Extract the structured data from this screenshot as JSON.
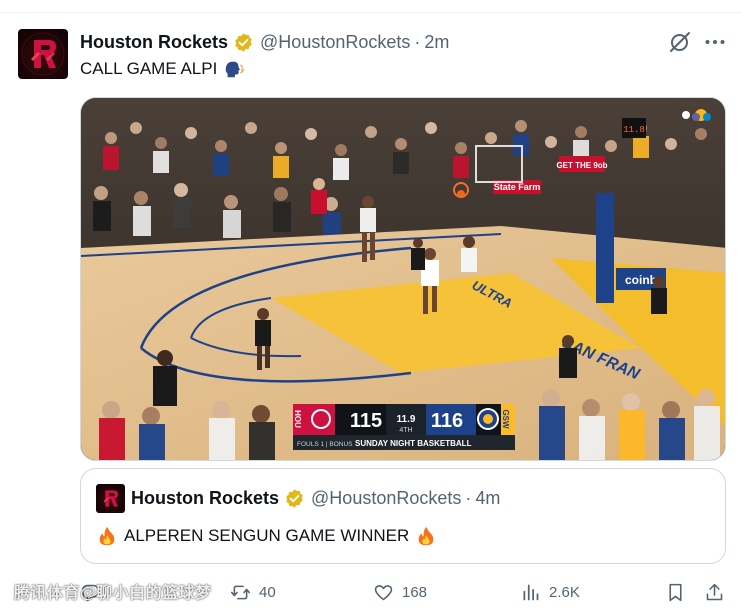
{
  "tweet": {
    "author": {
      "display_name": "Houston Rockets",
      "handle": "@HoustonRockets",
      "verified": true,
      "avatar_icon": "rockets-logo"
    },
    "time": "2m",
    "separator": "·",
    "text": "CALL GAME ALPI",
    "text_emoji": "speaking-head-emoji"
  },
  "media": {
    "type": "video-frame",
    "scorebug": {
      "home_team": "HOU",
      "home_score": "115",
      "clock": "11.9",
      "period": "4TH",
      "away_score": "116",
      "away_team": "GSW",
      "fouls_text": "FOULS 1 | BONUS",
      "broadcast": "SUNDAY NIGHT BASKETBALL"
    },
    "court_text": "SAN FRAN",
    "court_text2": "ULTRA",
    "ad_get_the": "GET THE 9ob",
    "ad_statefarm": "State Farm",
    "ad_coinbase": "coinb",
    "shot_clock": "11.8"
  },
  "quoted_tweet": {
    "author": {
      "display_name": "Houston Rockets",
      "handle": "@HoustonRockets",
      "verified": true
    },
    "time": "4m",
    "separator": "·",
    "text": "ALPEREN SENGUN GAME WINNER"
  },
  "actions": {
    "replies": "",
    "reposts": "40",
    "likes": "168",
    "views": "2.6K"
  },
  "watermark": "腾讯体育@聊小白的篮球梦",
  "colors": {
    "verified_gold": "#e2b719",
    "text_primary": "#0f1419",
    "text_secondary": "#536471",
    "border": "#cfd9de",
    "rockets_red": "#ce1141"
  }
}
